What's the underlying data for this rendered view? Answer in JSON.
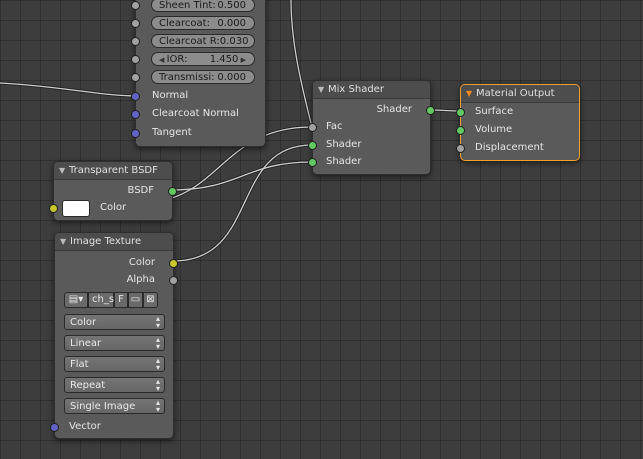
{
  "principled": {
    "fields": [
      {
        "label": "Sheen Tint:",
        "value": "0.500"
      },
      {
        "label": "Clearcoat:",
        "value": "0.000"
      },
      {
        "label": "Clearcoat R:",
        "value": "0.030"
      },
      {
        "label": "IOR:",
        "value": "1.450"
      },
      {
        "label": "Transmissi:",
        "value": "0.000"
      }
    ],
    "inputs": [
      "Normal",
      "Clearcoat Normal",
      "Tangent"
    ]
  },
  "transparent": {
    "title": "Transparent BSDF",
    "output": "BSDF",
    "color_label": "Color",
    "color_value": "#ffffff"
  },
  "image_texture": {
    "title": "Image Texture",
    "outputs": [
      "Color",
      "Alpha"
    ],
    "image_name": "ch_s",
    "fake_user": "F",
    "color_mode": "Color",
    "interpolation": "Linear",
    "projection": "Flat",
    "extension": "Repeat",
    "source": "Single Image",
    "vector_label": "Vector"
  },
  "mix_shader": {
    "title": "Mix Shader",
    "output": "Shader",
    "inputs": [
      "Fac",
      "Shader",
      "Shader"
    ]
  },
  "material_output": {
    "title": "Material Output",
    "inputs": [
      "Surface",
      "Volume",
      "Displacement"
    ]
  },
  "colors": {
    "background": "#3d3d3d",
    "node_body": "#5a5a5a",
    "active_outline": "#f0a030",
    "socket_shader": "#63c763",
    "socket_color": "#c7c729",
    "socket_vector": "#6363c7",
    "socket_float": "#a1a1a1"
  }
}
